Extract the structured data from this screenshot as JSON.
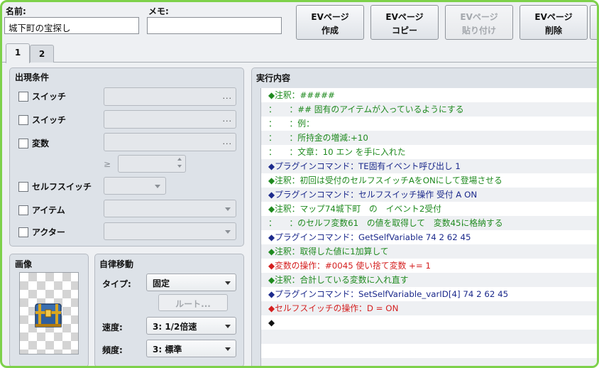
{
  "header": {
    "name_label": "名前:",
    "name_value": "城下町の宝探し",
    "memo_label": "メモ:",
    "memo_value": ""
  },
  "ev_buttons": [
    {
      "line1": "EVページ",
      "line2": "作成",
      "enabled": true
    },
    {
      "line1": "EVページ",
      "line2": "コピー",
      "enabled": true
    },
    {
      "line1": "EVページ",
      "line2": "貼り付け",
      "enabled": false
    },
    {
      "line1": "EVページ",
      "line2": "削除",
      "enabled": true
    }
  ],
  "tabs": [
    "1",
    "2"
  ],
  "conditions": {
    "title": "出現条件",
    "switch1": "スイッチ",
    "switch2": "スイッチ",
    "variable": "変数",
    "gte": "≥",
    "self_switch": "セルフスイッチ",
    "item": "アイテム",
    "actor": "アクター",
    "dots": "..."
  },
  "image": {
    "title": "画像"
  },
  "autonomous": {
    "title": "自律移動",
    "type_label": "タイプ:",
    "type_value": "固定",
    "route_button": "ルート...",
    "speed_label": "速度:",
    "speed_value": "3: 1/2倍速",
    "freq_label": "頻度:",
    "freq_value": "3: 標準"
  },
  "contents": {
    "title": "実行内容",
    "lines": [
      {
        "text": "◆注釈：#####",
        "color": "#1f8a1f"
      },
      {
        "text": "：　　：## 固有のアイテムが入っているようにする",
        "color": "#1f8a1f"
      },
      {
        "text": "：　　：例：",
        "color": "#1f8a1f"
      },
      {
        "text": "：　　：所持金の増減:+10",
        "color": "#1f8a1f"
      },
      {
        "text": "：　　：文章：10 エン を手に入れた",
        "color": "#1f8a1f"
      },
      {
        "text": "◆プラグインコマンド：TE固有イベント呼び出し 1",
        "color": "#1c2a8c"
      },
      {
        "text": "◆注釈：初回は受付のセルフスイッチAをONにして登場させる",
        "color": "#1f8a1f"
      },
      {
        "text": "◆プラグインコマンド：セルフスイッチ操作 受付 A ON",
        "color": "#1c2a8c"
      },
      {
        "text": "◆注釈：マップ74城下町　の　イベント2受付",
        "color": "#1f8a1f"
      },
      {
        "text": "：　　：のセルフ変数61　の値を取得して　変数45に格納する",
        "color": "#1f8a1f"
      },
      {
        "text": "◆プラグインコマンド：GetSelfVariable 74 2 62 45",
        "color": "#1c2a8c"
      },
      {
        "text": "◆注釈：取得した値に1加算して",
        "color": "#1f8a1f"
      },
      {
        "text": "◆変数の操作：#0045 使い捨て変数 += 1",
        "color": "#d41f1f"
      },
      {
        "text": "◆注釈：合計している変数に入れ直す",
        "color": "#1f8a1f"
      },
      {
        "text": "◆プラグインコマンド：SetSelfVariable_varID[4] 74 2 62 45",
        "color": "#1c2a8c"
      },
      {
        "text": "◆セルフスイッチの操作：D = ON",
        "color": "#d41f1f"
      },
      {
        "text": "◆",
        "color": "#111111"
      }
    ]
  }
}
